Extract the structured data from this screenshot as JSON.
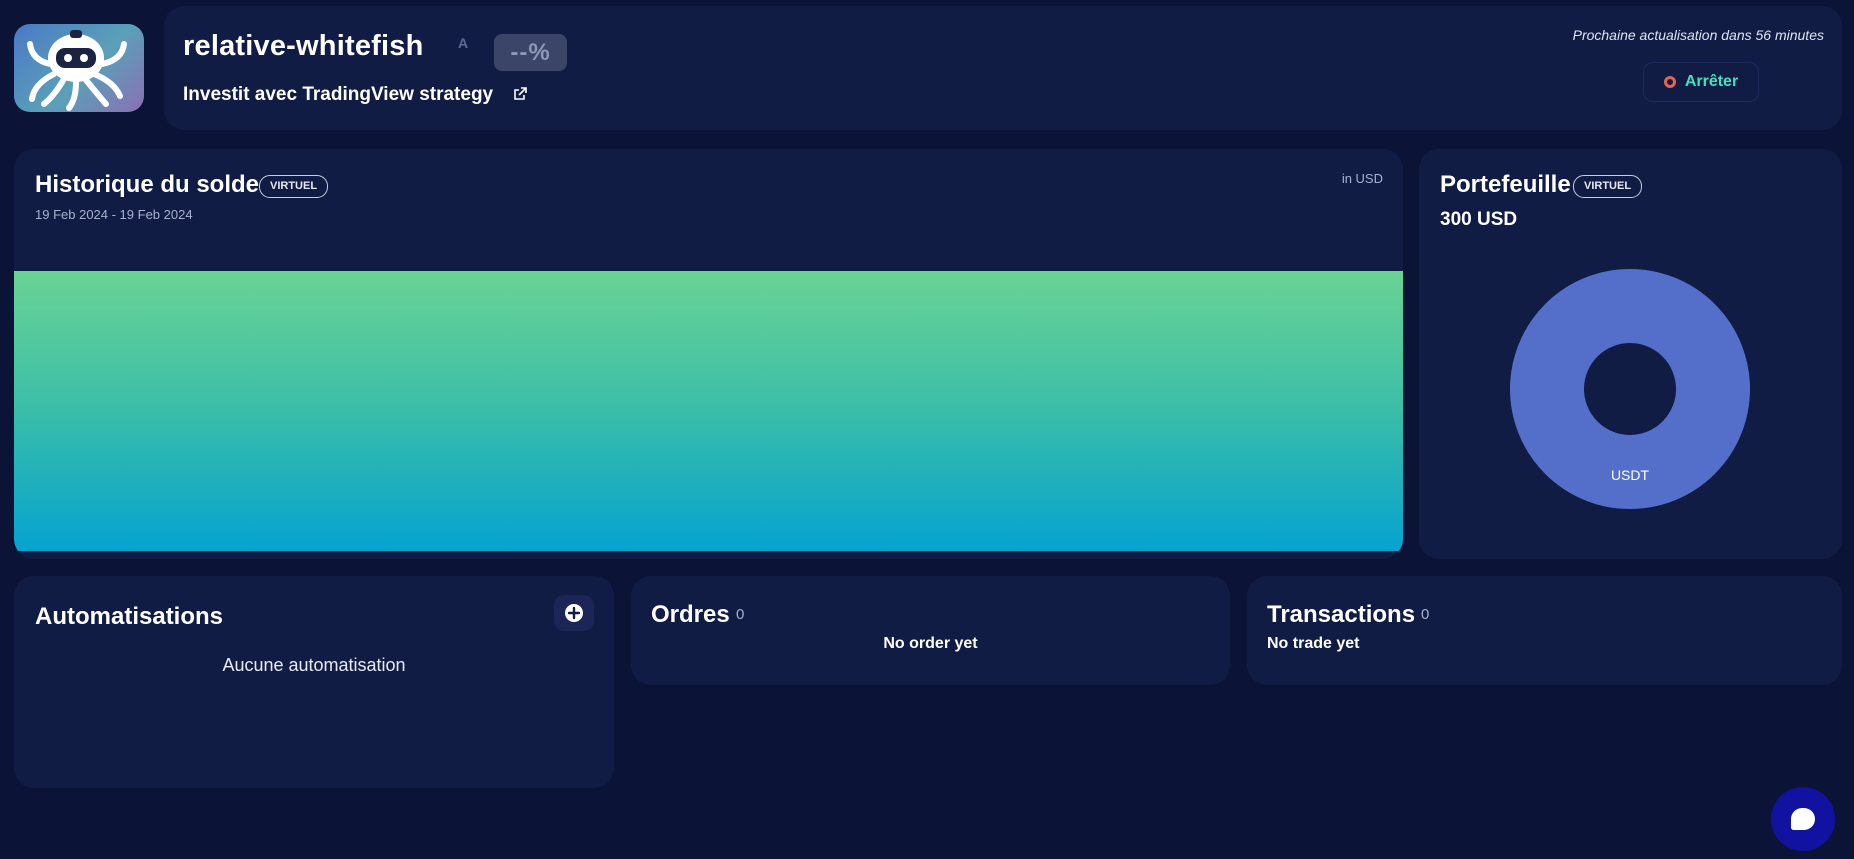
{
  "bot": {
    "name": "relative-whitefish",
    "name_mark": "A",
    "performance": "--%",
    "strategy": "Investit avec TradingView strategy",
    "next_update": "Prochaine actualisation dans 56 minutes",
    "stop_label": "Arrêter"
  },
  "history": {
    "title": "Historique du solde",
    "badge": "VIRTUEL",
    "range": "19 Feb 2024 - 19 Feb 2024",
    "unit": "in USD"
  },
  "portfolio": {
    "title": "Portefeuille",
    "badge": "VIRTUEL",
    "total": "300 USD"
  },
  "automations": {
    "title": "Automatisations",
    "empty": "Aucune automatisation"
  },
  "orders": {
    "title": "Ordres",
    "count": "0",
    "empty": "No order yet"
  },
  "transactions": {
    "title": "Transactions",
    "count": "0",
    "empty": "No trade yet"
  },
  "chart_data": [
    {
      "type": "area",
      "title": "Historique du solde",
      "subtitle": "19 Feb 2024 - 19 Feb 2024",
      "ylabel": "in USD",
      "series": [
        {
          "values": [
            300,
            300
          ]
        }
      ],
      "colors": [
        "#6ad395",
        "#05a3cf"
      ]
    },
    {
      "type": "pie",
      "title": "Portefeuille",
      "categories": [
        "USDT"
      ],
      "values": [
        300
      ],
      "colors": [
        "#536fc9"
      ]
    }
  ],
  "colors": {
    "background": "#0b1437",
    "card": "#111c44",
    "accent_green": "#46e0bf",
    "stop_icon": "#e0664f",
    "donut": "#536fc9",
    "chat_button": "#1212a0"
  },
  "icons": {
    "avatar": "octopus-robot-icon",
    "link": "external-link-icon",
    "stop": "stop-circle-icon",
    "add": "plus-circle-icon",
    "chat": "chat-bubble-icon"
  }
}
